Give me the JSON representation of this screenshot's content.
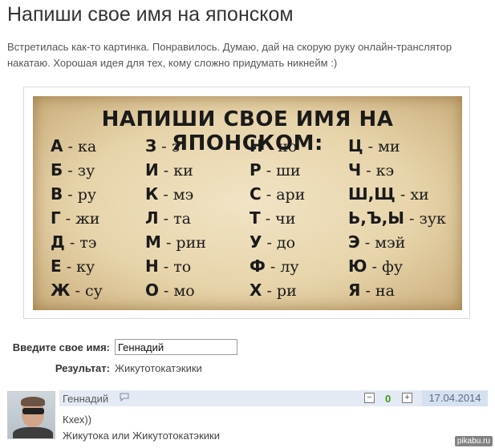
{
  "post": {
    "title": "Напиши свое имя на японском",
    "description": "Встретилась как-то картинка. Понравилось. Думаю, дай на скорую руку онлайн-транслятор накатаю. Хорошая идея для тех, кому сложно придумать никнейм :)"
  },
  "poster": {
    "title": "НАПИШИ СВОЕ ИМЯ НА ЯПОНСКОМ:",
    "rows": [
      [
        [
          "А",
          "ка"
        ],
        [
          "З",
          "з"
        ],
        [
          "Н",
          "но"
        ],
        [
          "Ц",
          "ми"
        ]
      ],
      [
        [
          "Б",
          "зу"
        ],
        [
          "И",
          "ки"
        ],
        [
          "Р",
          "ши"
        ],
        [
          "Ч",
          "кэ"
        ]
      ],
      [
        [
          "В",
          "ру"
        ],
        [
          "К",
          "мэ"
        ],
        [
          "С",
          "ари"
        ],
        [
          "Ш,Щ",
          "хи"
        ]
      ],
      [
        [
          "Г",
          "жи"
        ],
        [
          "Л",
          "та"
        ],
        [
          "Т",
          "чи"
        ],
        [
          "Ь,Ъ,Ы",
          "зук"
        ]
      ],
      [
        [
          "Д",
          "тэ"
        ],
        [
          "М",
          "рин"
        ],
        [
          "У",
          "до"
        ],
        [
          "Э",
          "мэй"
        ]
      ],
      [
        [
          "Е",
          "ку"
        ],
        [
          "Н",
          "то"
        ],
        [
          "Ф",
          "лу"
        ],
        [
          "Ю",
          "фу"
        ]
      ],
      [
        [
          "Ж",
          "су"
        ],
        [
          "О",
          "мо"
        ],
        [
          "Х",
          "ри"
        ],
        [
          "Я",
          "на"
        ]
      ]
    ]
  },
  "translator": {
    "input_label": "Введите свое имя:",
    "input_value": "Геннадий",
    "result_label": "Результат:",
    "result_value": "Жикутотокатэкики"
  },
  "comment": {
    "author": "Геннадий",
    "score": "0",
    "date": "17.04.2014",
    "line1": "Кхех))",
    "line2": "Жикутока или Жикутотокатэкики"
  },
  "watermark": "pikabu.ru"
}
